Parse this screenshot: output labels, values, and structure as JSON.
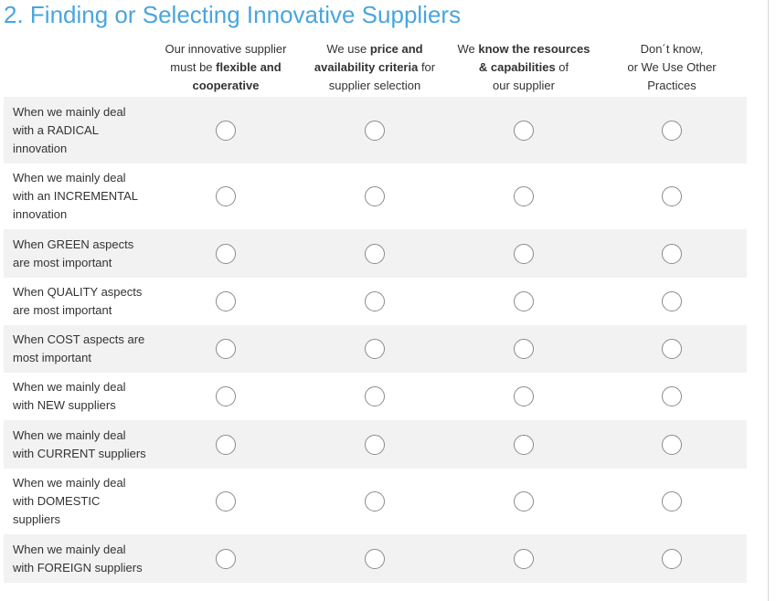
{
  "title": "2. Finding or Selecting Innovative Suppliers",
  "columns": [
    {
      "lines": [
        [
          {
            "t": "Our innovative supplier",
            "b": false
          }
        ],
        [
          {
            "t": "must be ",
            "b": false
          },
          {
            "t": "flexible and",
            "b": true
          }
        ],
        [
          {
            "t": "cooperative",
            "b": true
          }
        ]
      ]
    },
    {
      "lines": [
        [
          {
            "t": "We use ",
            "b": false
          },
          {
            "t": "price and",
            "b": true
          }
        ],
        [
          {
            "t": "availability criteria",
            "b": true
          },
          {
            "t": " for",
            "b": false
          }
        ],
        [
          {
            "t": "supplier selection",
            "b": false
          }
        ]
      ]
    },
    {
      "lines": [
        [
          {
            "t": "We ",
            "b": false
          },
          {
            "t": "know the resources",
            "b": true
          }
        ],
        [
          {
            "t": "& capabilities",
            "b": true
          },
          {
            "t": " of",
            "b": false
          }
        ],
        [
          {
            "t": "our supplier",
            "b": false
          }
        ]
      ]
    },
    {
      "lines": [
        [
          {
            "t": "Don´t know,",
            "b": false
          }
        ],
        [
          {
            "t": "or We Use Other",
            "b": false
          }
        ],
        [
          {
            "t": "Practices",
            "b": false
          }
        ]
      ]
    }
  ],
  "rows": [
    {
      "lines": [
        "When we mainly deal",
        "with a RADICAL",
        "innovation"
      ],
      "selected": null
    },
    {
      "lines": [
        "When we mainly deal",
        "with an INCREMENTAL",
        "innovation"
      ],
      "selected": null
    },
    {
      "lines": [
        "When GREEN aspects",
        "are most important"
      ],
      "selected": null
    },
    {
      "lines": [
        "When QUALITY aspects",
        "are most important"
      ],
      "selected": null
    },
    {
      "lines": [
        "When COST aspects are",
        "most important"
      ],
      "selected": null
    },
    {
      "lines": [
        "When we mainly deal",
        "with NEW suppliers"
      ],
      "selected": null
    },
    {
      "lines": [
        "When we mainly deal",
        "with CURRENT suppliers"
      ],
      "selected": null
    },
    {
      "lines": [
        "When we mainly deal",
        "with DOMESTIC",
        "suppliers"
      ],
      "selected": null
    },
    {
      "lines": [
        "When we mainly deal",
        "with FOREIGN suppliers"
      ],
      "selected": null
    }
  ],
  "colors": {
    "title": "#49a5dd",
    "row_shade": "#f2f2f2",
    "radio_border": "#8a8a8a"
  }
}
